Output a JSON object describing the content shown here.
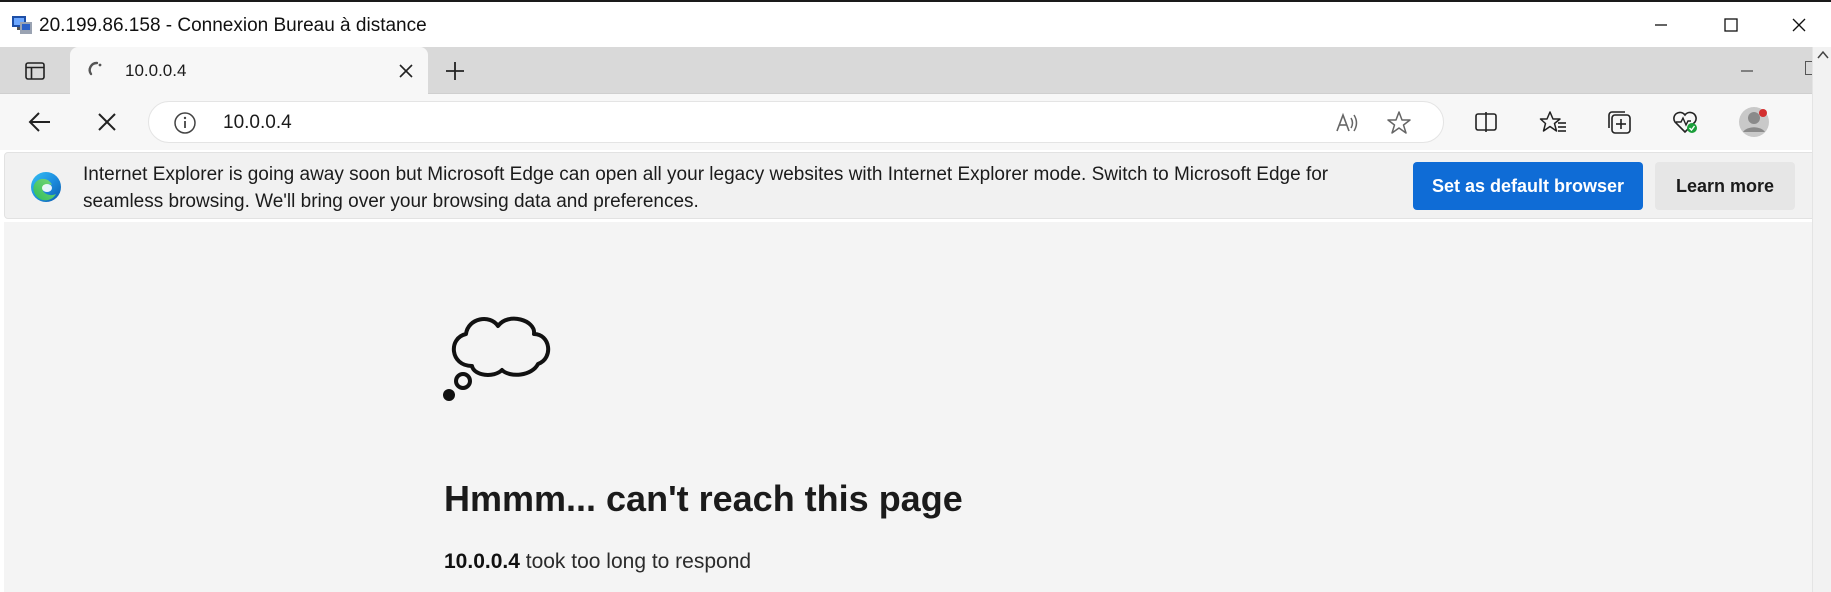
{
  "rdp_window": {
    "title": "20.199.86.158 - Connexion Bureau à distance",
    "icon": "remote-desktop-icon",
    "controls": [
      "minimize-icon",
      "maximize-icon",
      "close-icon"
    ]
  },
  "browser": {
    "tab": {
      "title": "10.0.0.4",
      "loading": true,
      "icon": "loading-spinner-icon"
    },
    "toolbar": {
      "url": "10.0.0.4",
      "icons": [
        "back-arrow-icon",
        "stop-loading-icon",
        "site-info-icon",
        "read-aloud-icon",
        "add-favorite-icon",
        "split-screen-icon",
        "favorites-icon",
        "collections-icon",
        "browser-essentials-icon",
        "profile-avatar-icon"
      ]
    },
    "infobar": {
      "message": "Internet Explorer is going away soon but Microsoft Edge can open all your legacy websites with Internet Explorer mode. Switch to Microsoft Edge for seamless browsing. We'll bring over your browsing data and preferences.",
      "primary_button": "Set as default browser",
      "secondary_button": "Learn more",
      "icon": "edge-logo-icon"
    }
  },
  "error_page": {
    "icon": "thought-cloud-icon",
    "title": "Hmmm... can't reach this page",
    "host": "10.0.0.4",
    "detail_suffix": " took too long to respond"
  },
  "colors": {
    "primary_button": "#0f6cd6",
    "tabstrip": "#d9d9d9",
    "content_bg": "#f4f4f4"
  }
}
